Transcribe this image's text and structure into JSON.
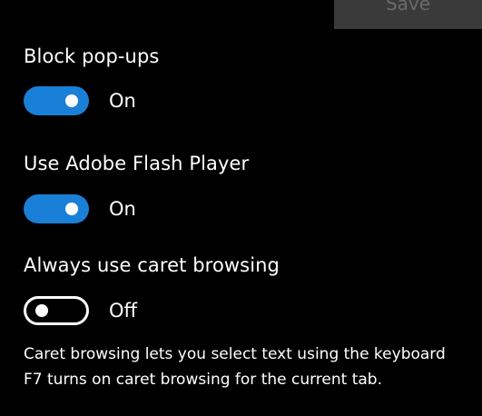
{
  "header": {
    "save_label": "Save"
  },
  "settings": [
    {
      "label": "Block pop-ups",
      "state": "On",
      "enabled": true
    },
    {
      "label": "Use Adobe Flash Player",
      "state": "On",
      "enabled": true
    },
    {
      "label": "Always use caret browsing",
      "state": "Off",
      "enabled": false
    }
  ],
  "caret_description": {
    "line1": "Caret browsing lets you select text using the keyboard",
    "line2": "F7 turns on caret browsing for the current tab."
  },
  "colors": {
    "background": "#000000",
    "toggle_on": "#1a7fd6",
    "toggle_off_border": "#ffffff",
    "save_button_bg": "#3a3a3a",
    "save_button_text": "#6a6a6a"
  }
}
